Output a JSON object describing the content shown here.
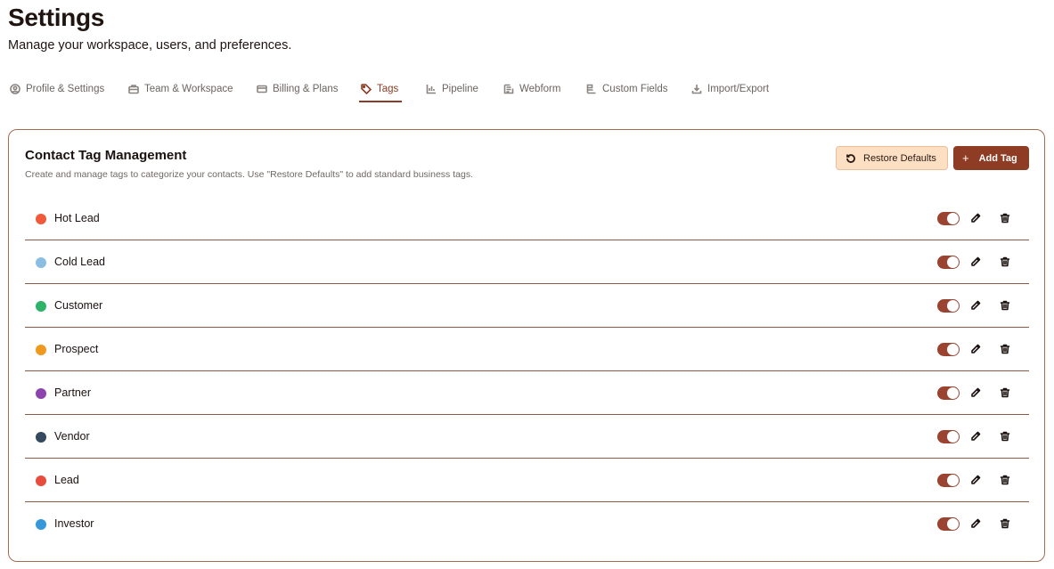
{
  "header": {
    "title": "Settings",
    "subtitle": "Manage your workspace, users, and preferences."
  },
  "tabs": [
    {
      "label": "Profile & Settings",
      "icon": "user-circle-icon",
      "active": false
    },
    {
      "label": "Team & Workspace",
      "icon": "briefcase-icon",
      "active": false
    },
    {
      "label": "Billing & Plans",
      "icon": "credit-card-icon",
      "active": false
    },
    {
      "label": "Tags",
      "icon": "tag-icon",
      "active": true
    },
    {
      "label": "Pipeline",
      "icon": "chart-icon",
      "active": false
    },
    {
      "label": "Webform",
      "icon": "form-icon",
      "active": false
    },
    {
      "label": "Custom Fields",
      "icon": "fields-icon",
      "active": false
    },
    {
      "label": "Import/Export",
      "icon": "download-icon",
      "active": false
    }
  ],
  "card": {
    "title": "Contact Tag Management",
    "description": "Create and manage tags to categorize your contacts. Use \"Restore Defaults\" to add standard business tags.",
    "restore_label": "Restore Defaults",
    "add_label": "Add Tag",
    "add_icon": "+"
  },
  "tags": [
    {
      "name": "Hot Lead",
      "color": "#f05a3a",
      "enabled": true
    },
    {
      "name": "Cold Lead",
      "color": "#8bbde3",
      "enabled": true
    },
    {
      "name": "Customer",
      "color": "#2eb368",
      "enabled": true
    },
    {
      "name": "Prospect",
      "color": "#f0991f",
      "enabled": true
    },
    {
      "name": "Partner",
      "color": "#8e44ad",
      "enabled": true
    },
    {
      "name": "Vendor",
      "color": "#34495e",
      "enabled": true
    },
    {
      "name": "Lead",
      "color": "#e74c3c",
      "enabled": true
    },
    {
      "name": "Investor",
      "color": "#3498db",
      "enabled": true
    }
  ],
  "colors": {
    "accent": "#8e3c24",
    "restore_bg": "#fde0c4",
    "toggle_on": "#9a4330"
  }
}
